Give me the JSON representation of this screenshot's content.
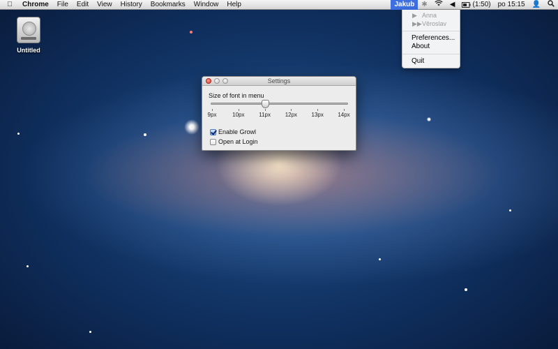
{
  "menubar": {
    "app_name": "Chrome",
    "menus": [
      "File",
      "Edit",
      "View",
      "History",
      "Bookmarks",
      "Window",
      "Help"
    ],
    "status": {
      "user": "Jakub",
      "battery": "(1:50)",
      "clock": "po 15:15"
    },
    "accent_color": "#3d6fe0"
  },
  "dropdown": {
    "disabled_items": [
      {
        "glyph": "▶",
        "label": "Anna"
      },
      {
        "glyph": "▶▶",
        "label": "Věroslav"
      }
    ],
    "items": [
      "Preferences...",
      "About",
      "Quit"
    ]
  },
  "desktop": {
    "disk_label": "Untitled"
  },
  "settings": {
    "title": "Settings",
    "slider_label": "Size of font in menu",
    "tick_labels": [
      "9px",
      "10px",
      "11px",
      "12px",
      "13px",
      "14px"
    ],
    "slider_value_index": 2,
    "enable_growl_label": "Enable Growl",
    "enable_growl_checked": true,
    "open_at_login_label": "Open at Login",
    "open_at_login_checked": false
  }
}
